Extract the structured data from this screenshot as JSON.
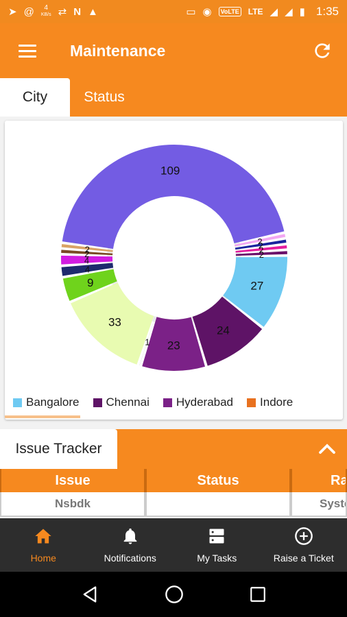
{
  "status_bar": {
    "speed_value": "4",
    "speed_unit": "KB/s",
    "volte": "VoLTE",
    "lte": "LTE",
    "time": "1:35"
  },
  "app": {
    "title": "Maintenance"
  },
  "tabs": [
    {
      "label": "City",
      "active": true
    },
    {
      "label": "Status",
      "active": false
    }
  ],
  "chart_data": {
    "type": "pie",
    "variant": "donut",
    "slices": [
      {
        "label": "Bangalore",
        "value": 27,
        "color": "#6fcaf2"
      },
      {
        "label": "Chennai",
        "value": 24,
        "color": "#5e1366"
      },
      {
        "label": "Hyderabad",
        "value": 23,
        "color": "#7b2187"
      },
      {
        "label": "",
        "value": 1,
        "color": "#c8c8c8"
      },
      {
        "label": "",
        "value": 33,
        "color": "#e8fbb1"
      },
      {
        "label": "",
        "value": 9,
        "color": "#6fd31c"
      },
      {
        "label": "",
        "value": 4,
        "color": "#1e2a6e"
      },
      {
        "label": "",
        "value": 4,
        "color": "#d21ce0"
      },
      {
        "label": "",
        "value": 2,
        "color": "#7a4a24"
      },
      {
        "label": "",
        "value": 2,
        "color": "#d9a366"
      },
      {
        "label": "",
        "value": 109,
        "color": "#735ce3"
      },
      {
        "label": "",
        "value": 2,
        "color": "#f2a7f2"
      },
      {
        "label": "",
        "value": 2,
        "color": "#18249e"
      },
      {
        "label": "",
        "value": 2,
        "color": "#e31c9e"
      },
      {
        "label": "",
        "value": 2,
        "color": "#6a106a"
      }
    ],
    "legend": [
      {
        "label": "Bangalore",
        "color": "#6fcaf2"
      },
      {
        "label": "Chennai",
        "color": "#5e1366"
      },
      {
        "label": "Hyderabad",
        "color": "#7b2187"
      },
      {
        "label": "Indore",
        "color": "#e8711f"
      }
    ],
    "legend_position": "bottom"
  },
  "issue_tracker": {
    "title": "Issue Tracker",
    "columns": [
      "Issue",
      "Status",
      "Ra"
    ],
    "rows": [
      [
        "Nsbdk",
        "",
        "Syste"
      ]
    ]
  },
  "bottom_nav": [
    {
      "label": "Home",
      "icon": "home-icon",
      "active": true
    },
    {
      "label": "Notifications",
      "icon": "bell-icon",
      "active": false
    },
    {
      "label": "My Tasks",
      "icon": "tasks-icon",
      "active": false
    },
    {
      "label": "Raise a Ticket",
      "icon": "plus-circle-icon",
      "active": false
    }
  ],
  "colors": {
    "primary": "#f6891f",
    "nav_bg": "#2d2d2d"
  }
}
